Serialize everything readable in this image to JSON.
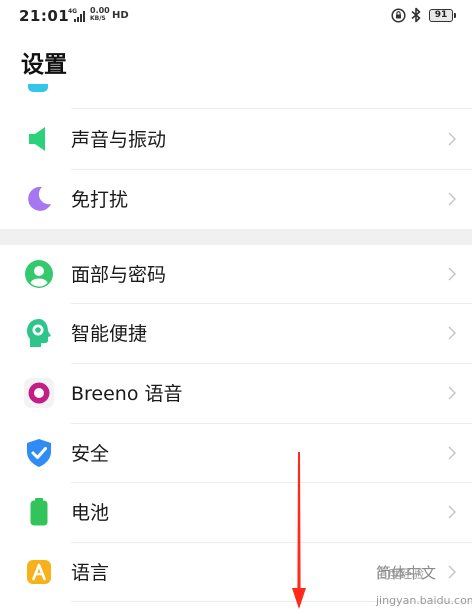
{
  "status_bar": {
    "time": "21:01",
    "network": "4G",
    "speed_value": "0.00",
    "speed_unit": "KB/S",
    "hd": "HD",
    "battery": "91"
  },
  "page": {
    "title": "设置"
  },
  "items": [
    {
      "label": "声音与振动",
      "icon": "speaker-icon"
    },
    {
      "label": "免打扰",
      "icon": "moon-icon"
    },
    {
      "label": "面部与密码",
      "icon": "face-id-icon"
    },
    {
      "label": "智能便捷",
      "icon": "smart-head-icon"
    },
    {
      "label": "Breeno 语音",
      "icon": "breeno-ring-icon"
    },
    {
      "label": "安全",
      "icon": "shield-check-icon"
    },
    {
      "label": "电池",
      "icon": "battery-icon"
    },
    {
      "label": "语言",
      "icon": "language-a-icon",
      "value": "简体中文"
    }
  ],
  "watermark": {
    "text": "百度经验",
    "sub": "jingyan.baidu.com"
  },
  "colors": {
    "speaker": "#2bd27a",
    "moon": "#a777f2",
    "face": "#35c96e",
    "smart": "#2dc58a",
    "breeno": "#c21f86",
    "shield": "#2f8cf5",
    "battery": "#32c45a",
    "language": "#f7b21b",
    "arrow": "#ff2a1a"
  }
}
